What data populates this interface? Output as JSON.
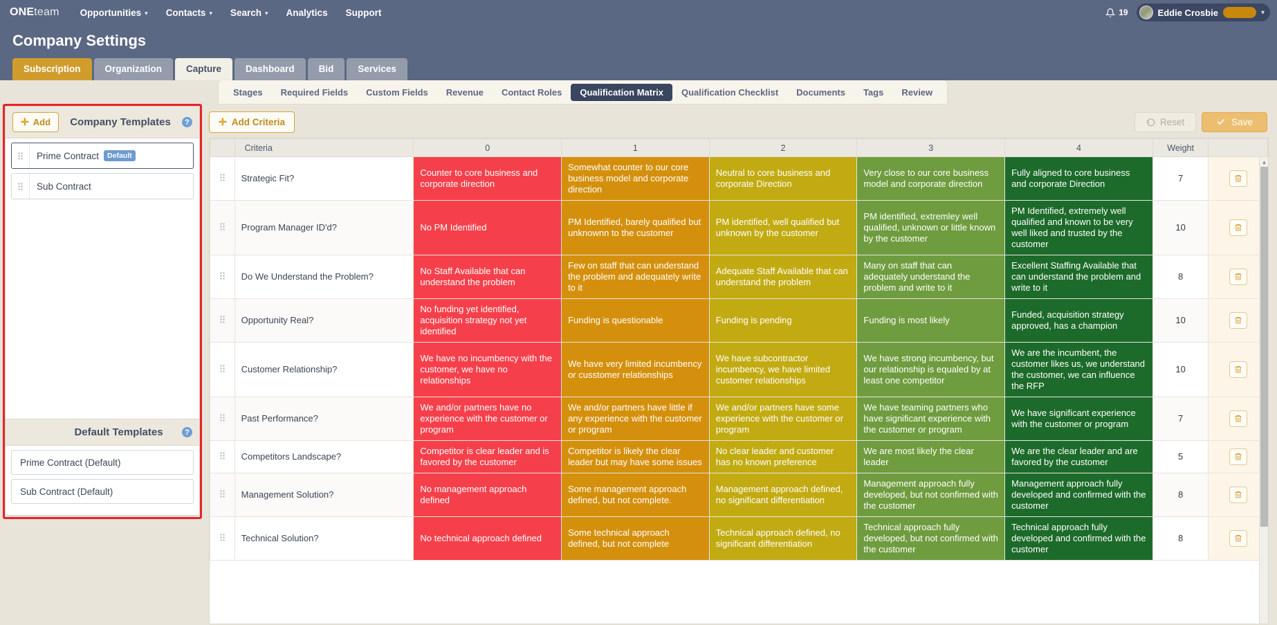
{
  "topnav": {
    "brand_bold": "ONE",
    "brand_light": "team",
    "items": [
      {
        "label": "Opportunities",
        "caret": true
      },
      {
        "label": "Contacts",
        "caret": true
      },
      {
        "label": "Search",
        "caret": true
      },
      {
        "label": "Analytics",
        "caret": false
      },
      {
        "label": "Support",
        "caret": false
      }
    ],
    "notification_count": "19",
    "user_name": "Eddie Crosbie"
  },
  "page": {
    "title": "Company Settings",
    "tabs": [
      {
        "label": "Subscription",
        "state": "active-orange"
      },
      {
        "label": "Organization",
        "state": "normal"
      },
      {
        "label": "Capture",
        "state": "active-light"
      },
      {
        "label": "Dashboard",
        "state": "normal"
      },
      {
        "label": "Bid",
        "state": "normal"
      },
      {
        "label": "Services",
        "state": "normal"
      }
    ],
    "subtabs": [
      {
        "label": "Stages",
        "active": false
      },
      {
        "label": "Required Fields",
        "active": false
      },
      {
        "label": "Custom Fields",
        "active": false
      },
      {
        "label": "Revenue",
        "active": false
      },
      {
        "label": "Contact Roles",
        "active": false
      },
      {
        "label": "Qualification Matrix",
        "active": true
      },
      {
        "label": "Qualification Checklist",
        "active": false
      },
      {
        "label": "Documents",
        "active": false
      },
      {
        "label": "Tags",
        "active": false
      },
      {
        "label": "Review",
        "active": false
      }
    ]
  },
  "left_panel": {
    "add_label": "Add",
    "company_templates_title": "Company Templates",
    "default_templates_title": "Default Templates",
    "company_templates": [
      {
        "name": "Prime Contract",
        "badge": "Default",
        "selected": true
      },
      {
        "name": "Sub Contract",
        "badge": "",
        "selected": false
      }
    ],
    "default_templates": [
      {
        "name": "Prime Contract (Default)"
      },
      {
        "name": "Sub Contract (Default)"
      }
    ]
  },
  "toolbar": {
    "add_criteria_label": "Add Criteria",
    "reset_label": "Reset",
    "save_label": "Save"
  },
  "matrix": {
    "headers": [
      "Criteria",
      "0",
      "1",
      "2",
      "3",
      "4",
      "Weight"
    ],
    "score_colors": [
      "#f5404b",
      "#d4900d",
      "#c2ab12",
      "#6f9c3f",
      "#1d6b2a"
    ],
    "rows": [
      {
        "criteria": "Strategic Fit?",
        "weight": "7",
        "scores": [
          "Counter to core business and corporate direction",
          "Somewhat counter to our core business model and corporate direction",
          "Neutral to core business and corporate Direction",
          "Very close to our core business model and corporate direction",
          "Fully aligned to core business and corporate Direction"
        ]
      },
      {
        "criteria": "Program Manager ID'd?",
        "weight": "10",
        "scores": [
          "No PM Identified",
          "PM Identified, barely qualified but unknownn to the customer",
          "PM identified, well qualified but unknown by the customer",
          "PM identified, extremley well qualified, unknown or little known by the customer",
          "PM Identified, extremely well qualified and known to be very well liked and trusted by the customer"
        ]
      },
      {
        "criteria": "Do We Understand the Problem?",
        "weight": "8",
        "scores": [
          "No Staff Available that can understand the problem",
          "Few on staff that can understand the problem and adequately write to it",
          "Adequate Staff Available that can understand the problem",
          "Many on staff that can adequately understand the problem and write to it",
          "Excellent Staffing Available that can understand the problem and write to it"
        ]
      },
      {
        "criteria": "Opportunity Real?",
        "weight": "10",
        "scores": [
          "No funding yet identified, acquisition strategy not yet identified",
          "Funding is questionable",
          "Funding is pending",
          "Funding is most likely",
          "Funded, acquisition strategy approved, has a champion"
        ]
      },
      {
        "criteria": "Customer Relationship?",
        "weight": "10",
        "scores": [
          "We have no incumbency with the customer, we have no relationships",
          "We have very limited incumbency or cusstomer relationships",
          "We have subcontractor incumbency, we have limited customer relationships",
          "We have strong incumbency, but our relationship is equaled by at least one competitor",
          "We are the incumbent, the customer likes us, we understand the customer, we can influence the RFP"
        ]
      },
      {
        "criteria": "Past Performance?",
        "weight": "7",
        "scores": [
          "We and/or partners have no experience with the customer or program",
          "We and/or partners have little if any experience with the customer or program",
          "We and/or partners have some experience with the customer or program",
          "We have teaming partners who have significant experience with the customer or program",
          "We have significant experience with the customer or program"
        ]
      },
      {
        "criteria": "Competitors Landscape?",
        "weight": "5",
        "scores": [
          "Competitor is clear leader and is favored by the customer",
          "Competitor is likely the clear leader but may have some issues",
          "No clear leader and customer has no known preference",
          "We are most likely the clear leader",
          "We are the clear leader and are favored by the customer"
        ]
      },
      {
        "criteria": "Management Solution?",
        "weight": "8",
        "scores": [
          "No management approach defined",
          "Some management approach defined, but not complete.",
          "Management approach defined, no significant differentiation",
          "Management approach fully developed, but not confirmed with the customer",
          "Management approach fully developed and confirmed with the customer"
        ]
      },
      {
        "criteria": "Technical Solution?",
        "weight": "8",
        "scores": [
          "No technical approach defined",
          "Some technical approach defined, but not complete",
          "Technical approach defined, no significant differentiation",
          "Technical approach fully developed, but not confirmed with the customer",
          "Technical approach fully developed and confirmed with the customer"
        ]
      }
    ]
  }
}
